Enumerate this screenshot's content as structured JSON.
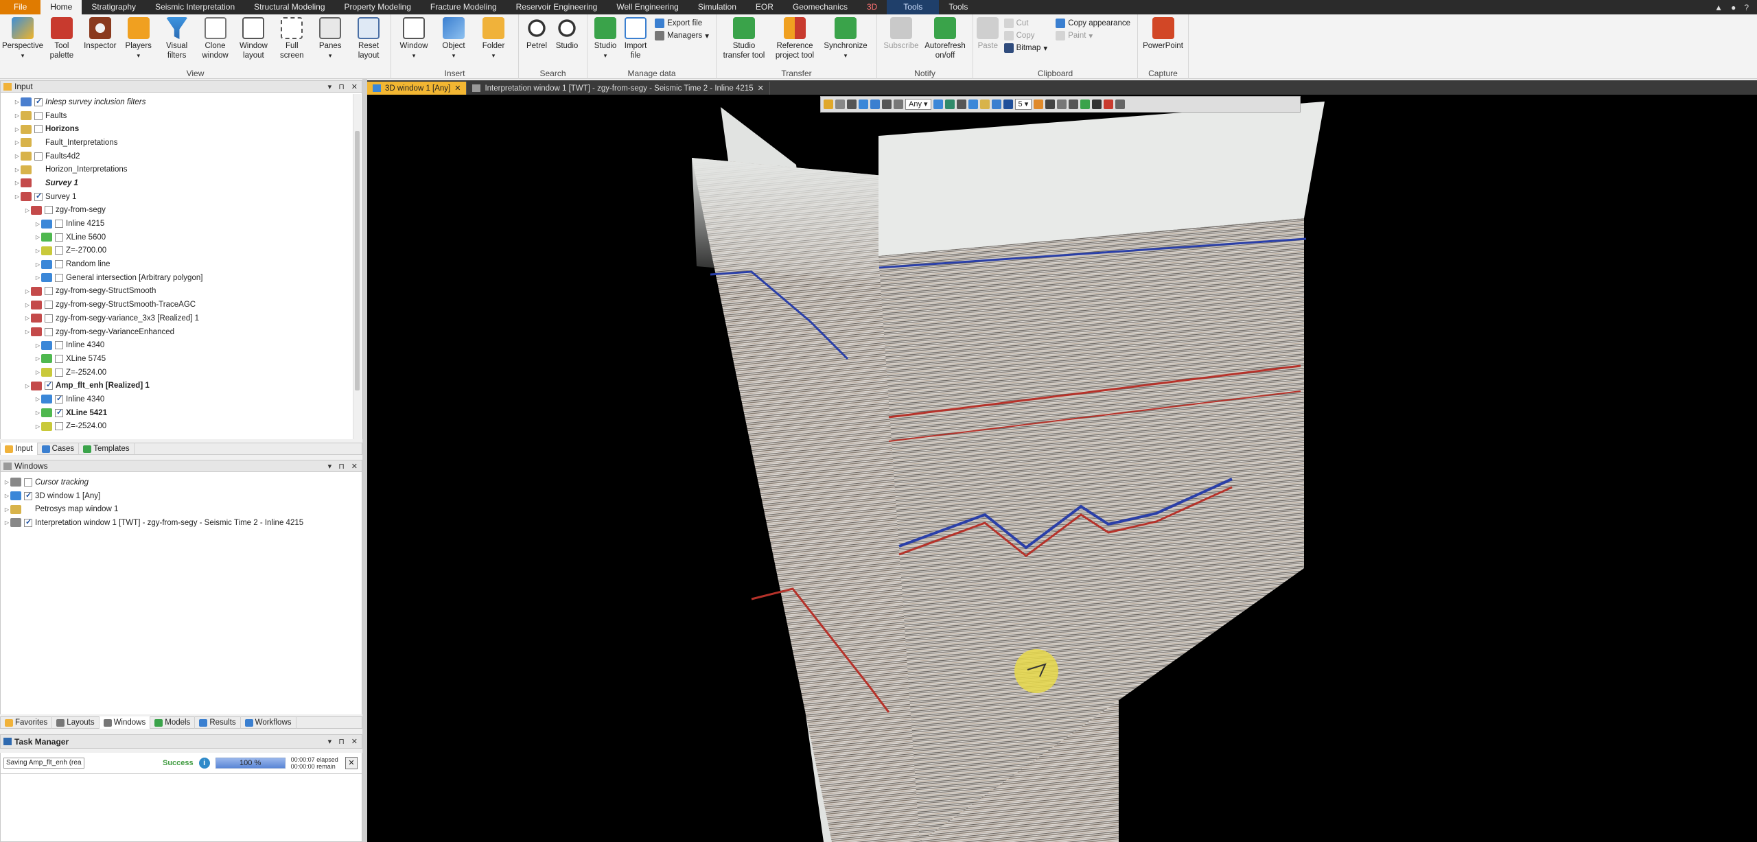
{
  "menubar": {
    "tabs": [
      "File",
      "Home",
      "Stratigraphy",
      "Seismic Interpretation",
      "Structural Modeling",
      "Property Modeling",
      "Fracture Modeling",
      "Reservoir Engineering",
      "Well Engineering",
      "Simulation",
      "EOR",
      "Geomechanics",
      "3D",
      "Tools",
      "Tools"
    ]
  },
  "ribbon": {
    "groups": {
      "view": "View",
      "insert": "Insert",
      "search": "Search",
      "manage": "Manage data",
      "transfer": "Transfer",
      "notify": "Notify",
      "clipboard": "Clipboard",
      "capture": "Capture"
    },
    "view_buttons": [
      "Perspective",
      "Tool palette",
      "Inspector",
      "Players",
      "Visual filters",
      "Clone window",
      "Window layout",
      "Full screen",
      "Panes",
      "Reset layout"
    ],
    "insert_buttons": [
      "Window",
      "Object",
      "Folder"
    ],
    "search_buttons": [
      "Petrel",
      "Studio"
    ],
    "manage_buttons": [
      "Studio",
      "Import file"
    ],
    "manage_small": [
      "Export file",
      "Managers"
    ],
    "transfer_buttons": [
      "Studio transfer tool",
      "Reference project tool",
      "Synchronize"
    ],
    "notify_buttons": [
      "Subscribe",
      "Autorefresh on/off"
    ],
    "clipboard_paste": "Paste",
    "clipboard_small": [
      "Cut",
      "Copy",
      "Bitmap",
      "Copy appearance",
      "Paint"
    ],
    "capture_buttons": [
      "PowerPoint"
    ]
  },
  "input_panel": {
    "title": "Input",
    "tree": [
      {
        "label": "Inlesp survey inclusion filters",
        "indent": 1,
        "checked": true,
        "style": "it",
        "color": "#4a7fcf"
      },
      {
        "label": "Faults",
        "indent": 1,
        "checked": false,
        "style": "",
        "color": "#d8b34a"
      },
      {
        "label": "Horizons",
        "indent": 1,
        "checked": false,
        "style": "bd",
        "color": "#d8b34a"
      },
      {
        "label": "Fault_Interpretations",
        "indent": 1,
        "checked": null,
        "style": "",
        "color": "#d8b34a"
      },
      {
        "label": "Faults4d2",
        "indent": 1,
        "checked": false,
        "style": "",
        "color": "#d8b34a"
      },
      {
        "label": "Horizon_Interpretations",
        "indent": 1,
        "checked": null,
        "style": "",
        "color": "#d8b34a"
      },
      {
        "label": "Survey 1",
        "indent": 1,
        "checked": null,
        "style": "it bd",
        "color": "#c44a4a"
      },
      {
        "label": "Survey 1",
        "indent": 1,
        "checked": true,
        "style": "",
        "color": "#c44a4a"
      },
      {
        "label": "zgy-from-segy",
        "indent": 2,
        "checked": false,
        "style": "",
        "color": "#c44a4a"
      },
      {
        "label": "Inline 4215",
        "indent": 3,
        "checked": false,
        "style": "",
        "color": "#3b87d8"
      },
      {
        "label": "XLine 5600",
        "indent": 3,
        "checked": false,
        "style": "",
        "color": "#4fb84f"
      },
      {
        "label": "Z=-2700.00",
        "indent": 3,
        "checked": false,
        "style": "",
        "color": "#c9c93a"
      },
      {
        "label": "Random line",
        "indent": 3,
        "checked": false,
        "style": "",
        "color": "#3b87d8"
      },
      {
        "label": "General intersection [Arbitrary polygon]",
        "indent": 3,
        "checked": false,
        "style": "",
        "color": "#3b87d8"
      },
      {
        "label": "zgy-from-segy-StructSmooth",
        "indent": 2,
        "checked": false,
        "style": "",
        "color": "#c44a4a"
      },
      {
        "label": "zgy-from-segy-StructSmooth-TraceAGC",
        "indent": 2,
        "checked": false,
        "style": "",
        "color": "#c44a4a"
      },
      {
        "label": "zgy-from-segy-variance_3x3 [Realized] 1",
        "indent": 2,
        "checked": false,
        "style": "",
        "color": "#c44a4a"
      },
      {
        "label": "zgy-from-segy-VarianceEnhanced",
        "indent": 2,
        "checked": false,
        "style": "",
        "color": "#c44a4a"
      },
      {
        "label": "Inline 4340",
        "indent": 3,
        "checked": false,
        "style": "",
        "color": "#3b87d8"
      },
      {
        "label": "XLine 5745",
        "indent": 3,
        "checked": false,
        "style": "",
        "color": "#4fb84f"
      },
      {
        "label": "Z=-2524.00",
        "indent": 3,
        "checked": false,
        "style": "",
        "color": "#c9c93a"
      },
      {
        "label": "Amp_flt_enh [Realized] 1",
        "indent": 2,
        "checked": true,
        "style": "bd",
        "color": "#c44a4a"
      },
      {
        "label": "Inline 4340",
        "indent": 3,
        "checked": true,
        "style": "",
        "color": "#3b87d8"
      },
      {
        "label": "XLine 5421",
        "indent": 3,
        "checked": true,
        "style": "bd",
        "color": "#4fb84f"
      },
      {
        "label": "Z=-2524.00",
        "indent": 3,
        "checked": false,
        "style": "",
        "color": "#c9c93a"
      }
    ],
    "tabs": [
      "Input",
      "Cases",
      "Templates"
    ]
  },
  "windows_panel": {
    "title": "Windows",
    "items": [
      {
        "label": "Cursor tracking",
        "checked": false,
        "style": "it",
        "color": "#888888"
      },
      {
        "label": "3D window 1 [Any]",
        "checked": true,
        "style": "",
        "color": "#3b87d8"
      },
      {
        "label": "Petrosys map window 1",
        "checked": null,
        "style": "",
        "color": "#d8b34a"
      },
      {
        "label": "Interpretation window 1 [TWT] - zgy-from-segy - Seismic Time 2 - Inline 4215",
        "checked": true,
        "style": "",
        "color": "#888888"
      }
    ],
    "tabs": [
      "Favorites",
      "Layouts",
      "Windows",
      "Models",
      "Results",
      "Workflows"
    ]
  },
  "task_manager": {
    "title": "Task Manager",
    "task_name": "Saving Amp_flt_enh (rea",
    "status": "Success",
    "progress": 100,
    "progress_label": "100 %",
    "elapsed": "00:00:07 elapsed",
    "remain": "00:00:00 remain"
  },
  "document_tabs": [
    {
      "label": "3D window 1 [Any]",
      "active": true
    },
    {
      "label": "Interpretation window 1 [TWT] - zgy-from-segy - Seismic Time 2 - Inline 4215",
      "active": false
    }
  ],
  "toolbar3d": {
    "domain_select": "Any",
    "number_field": "5"
  }
}
